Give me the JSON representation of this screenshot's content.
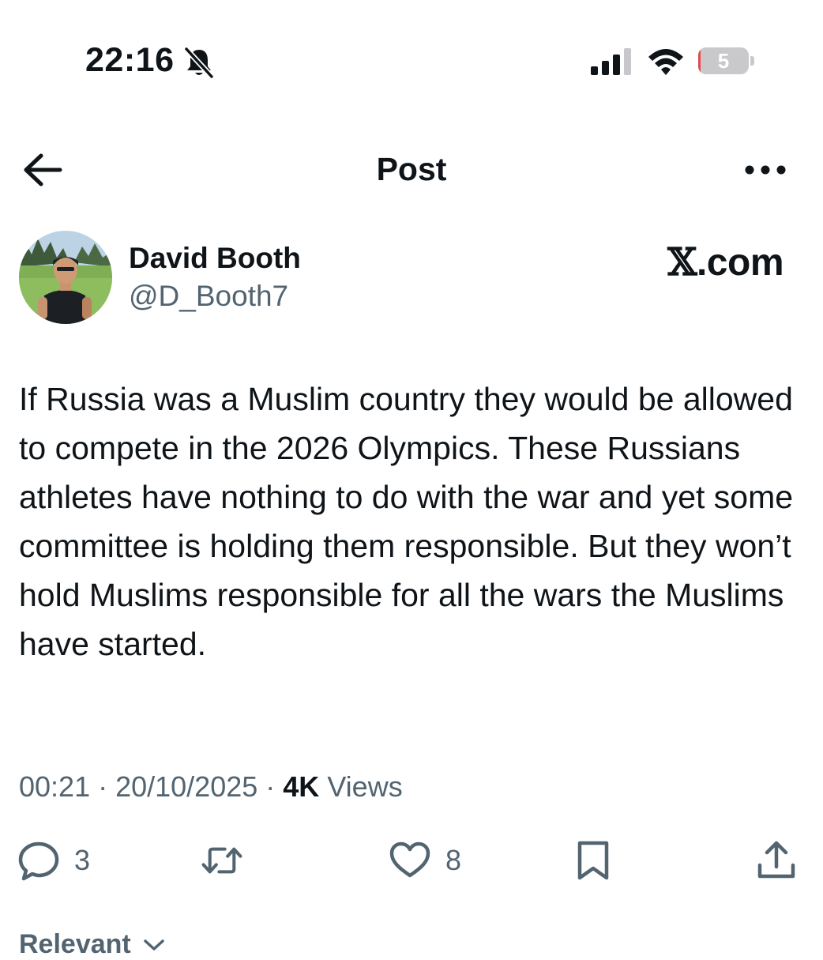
{
  "status_bar": {
    "time": "22:16",
    "battery_level": "5",
    "battery_fraction": 0.05,
    "icons": [
      "bell-off-icon",
      "signal-icon",
      "wifi-icon",
      "battery-icon"
    ]
  },
  "header": {
    "title": "Post",
    "back_icon": "arrow-left-icon",
    "more_icon": "more-horizontal-icon"
  },
  "author": {
    "name": "David Booth",
    "handle": "@D_Booth7"
  },
  "source_logo": {
    "glyph": "𝕏",
    "text": ".com"
  },
  "post": {
    "text": "If Russia was a Muslim country they would be allowed to compete in the 2026 Olympics. These Russians athletes have nothing to do with the war and yet some committee is holding them responsible. But they won’t hold Muslims responsible for all the wars the Muslims have started."
  },
  "meta": {
    "time": "00:21",
    "separator": " · ",
    "date": "20/10/2025",
    "views_count": "4K",
    "views_label": " Views"
  },
  "actions": {
    "reply_count": "3",
    "like_count": "8",
    "icons": [
      "reply-icon",
      "repost-icon",
      "like-icon",
      "bookmark-icon",
      "share-icon"
    ]
  },
  "sort": {
    "label": "Relevant",
    "icon": "chevron-down-icon"
  },
  "colors": {
    "text": "#0f1419",
    "secondary": "#536471",
    "battery_low": "#e5484d"
  }
}
